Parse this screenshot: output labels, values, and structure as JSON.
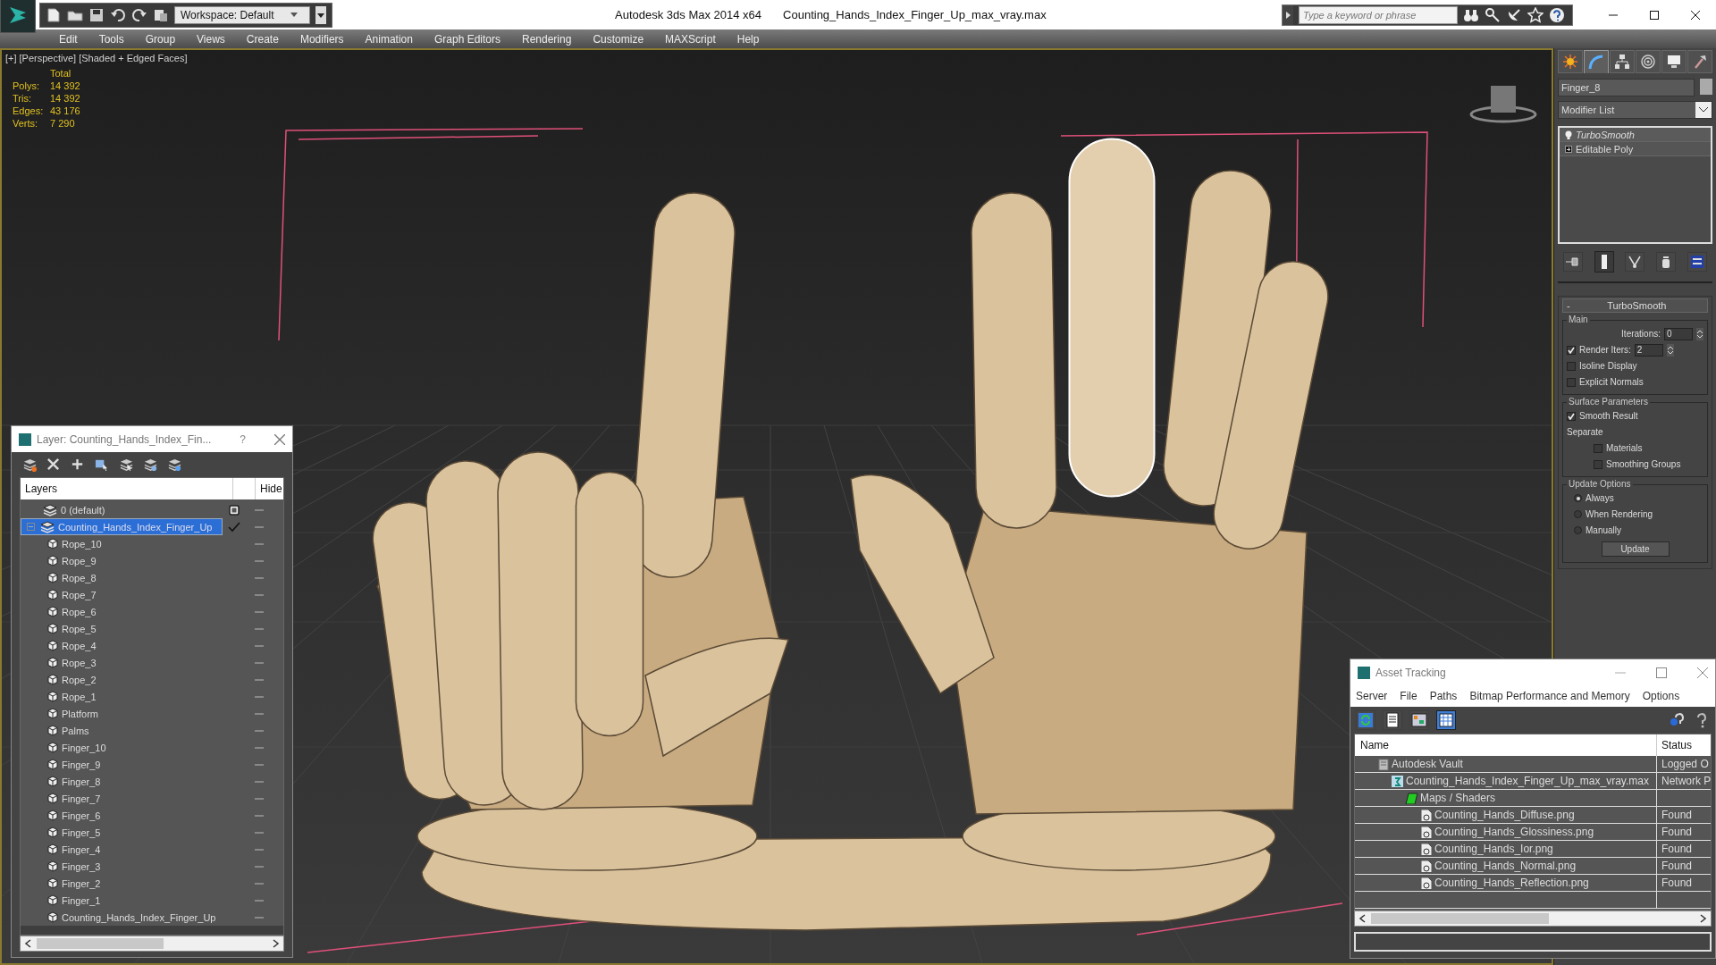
{
  "title_bar": {
    "app": "Autodesk 3ds Max  2014 x64",
    "file": "Counting_Hands_Index_Finger_Up_max_vray.max",
    "workspace": "Workspace: Default",
    "search": {
      "placeholder": "Type a keyword or phrase"
    }
  },
  "menu": [
    "Edit",
    "Tools",
    "Group",
    "Views",
    "Create",
    "Modifiers",
    "Animation",
    "Graph Editors",
    "Rendering",
    "Customize",
    "MAXScript",
    "Help"
  ],
  "viewport": {
    "labels": [
      "[+]",
      "[Perspective]",
      "[Shaded + Edged Faces]"
    ],
    "stats": {
      "header": "Total",
      "rows": [
        {
          "label": "Polys:",
          "value": "14 392"
        },
        {
          "label": "Tris:",
          "value": "14 392"
        },
        {
          "label": "Edges:",
          "value": "43 176"
        },
        {
          "label": "Verts:",
          "value": "7 290"
        }
      ]
    }
  },
  "command_panel": {
    "tabs": [
      {
        "kind": "create",
        "selected": false
      },
      {
        "kind": "modify",
        "selected": true
      },
      {
        "kind": "hierarchy",
        "selected": false
      },
      {
        "kind": "motion",
        "selected": false
      },
      {
        "kind": "display",
        "selected": false
      },
      {
        "kind": "utilities",
        "selected": false
      }
    ],
    "object_name": "Finger_8",
    "modifier_list": "Modifier List",
    "stack": [
      {
        "name": "TurboSmooth",
        "viewport_off": true,
        "expandable": false
      },
      {
        "name": "Editable Poly",
        "viewport_off": false,
        "expandable": true
      }
    ],
    "stack_tools": [
      {
        "kind": "pin",
        "selected": false
      },
      {
        "kind": "end_result",
        "selected": true
      },
      {
        "kind": "unique",
        "selected": false
      },
      {
        "kind": "remove",
        "selected": false
      },
      {
        "kind": "configure",
        "selected": false
      }
    ],
    "rollout": {
      "collapse": "-",
      "title": "TurboSmooth",
      "groups": [
        {
          "title": "Main",
          "controls": [
            {
              "kind": "spinner",
              "label": "Iterations:",
              "value": "0"
            },
            {
              "kind": "check_spinner",
              "label": "Render Iters:",
              "value": "2",
              "checked": true
            },
            {
              "kind": "checkbox",
              "label": "Isoline Display",
              "checked": false
            },
            {
              "kind": "checkbox",
              "label": "Explicit Normals",
              "checked": false
            }
          ]
        },
        {
          "title": "Surface Parameters",
          "controls": [
            {
              "kind": "checkbox",
              "label": "Smooth Result",
              "checked": true
            },
            {
              "kind": "label",
              "label": "Separate"
            },
            {
              "kind": "subcheckbox",
              "label": "Materials",
              "checked": false
            },
            {
              "kind": "subcheckbox",
              "label": "Smoothing Groups",
              "checked": false
            }
          ]
        },
        {
          "title": "Update Options",
          "controls": [
            {
              "kind": "radio",
              "label": "Always",
              "selected": true
            },
            {
              "kind": "radio",
              "label": "When Rendering",
              "selected": false
            },
            {
              "kind": "radio",
              "label": "Manually",
              "selected": false
            },
            {
              "kind": "button",
              "label": "Update"
            }
          ]
        }
      ]
    }
  },
  "layer_window": {
    "title": "Layer: Counting_Hands_Index_Fin...",
    "help": "?",
    "columns": [
      "Layers",
      "Hide"
    ],
    "layers": [
      {
        "name": "0 (default)",
        "kind": "layer",
        "current": false,
        "selected": false
      },
      {
        "name": "Counting_Hands_Index_Finger_Up",
        "kind": "layer",
        "current": true,
        "selected": true,
        "expanded": true,
        "children": [
          {
            "name": "Rope_10",
            "kind": "object"
          },
          {
            "name": "Rope_9",
            "kind": "object"
          },
          {
            "name": "Rope_8",
            "kind": "object"
          },
          {
            "name": "Rope_7",
            "kind": "object"
          },
          {
            "name": "Rope_6",
            "kind": "object"
          },
          {
            "name": "Rope_5",
            "kind": "object"
          },
          {
            "name": "Rope_4",
            "kind": "object"
          },
          {
            "name": "Rope_3",
            "kind": "object"
          },
          {
            "name": "Rope_2",
            "kind": "object"
          },
          {
            "name": "Rope_1",
            "kind": "object"
          },
          {
            "name": "Platform",
            "kind": "object"
          },
          {
            "name": "Palms",
            "kind": "object"
          },
          {
            "name": "Finger_10",
            "kind": "object"
          },
          {
            "name": "Finger_9",
            "kind": "object"
          },
          {
            "name": "Finger_8",
            "kind": "object"
          },
          {
            "name": "Finger_7",
            "kind": "object"
          },
          {
            "name": "Finger_6",
            "kind": "object"
          },
          {
            "name": "Finger_5",
            "kind": "object"
          },
          {
            "name": "Finger_4",
            "kind": "object"
          },
          {
            "name": "Finger_3",
            "kind": "object"
          },
          {
            "name": "Finger_2",
            "kind": "object"
          },
          {
            "name": "Finger_1",
            "kind": "object"
          },
          {
            "name": "Counting_Hands_Index_Finger_Up",
            "kind": "object"
          }
        ]
      }
    ]
  },
  "asset_window": {
    "title": "Asset Tracking",
    "menu": [
      "Server",
      "File",
      "Paths",
      "Bitmap Performance and Memory",
      "Options"
    ],
    "toolbar": [
      {
        "kind": "refresh",
        "selected": false
      },
      {
        "kind": "list",
        "selected": false
      },
      {
        "kind": "thumbnails",
        "selected": false
      },
      {
        "kind": "table",
        "selected": true
      }
    ],
    "columns": [
      "Name",
      "Status"
    ],
    "rows": [
      {
        "name": "Autodesk Vault",
        "kind": "vault",
        "status": "Logged O",
        "children": [
          {
            "name": "Counting_Hands_Index_Finger_Up_max_vray.max",
            "kind": "max",
            "status": "Network P",
            "children": [
              {
                "name": "Maps / Shaders",
                "kind": "folder",
                "children": [
                  {
                    "name": "Counting_Hands_Diffuse.png",
                    "kind": "image",
                    "status": "Found"
                  },
                  {
                    "name": "Counting_Hands_Glossiness.png",
                    "kind": "image",
                    "status": "Found"
                  },
                  {
                    "name": "Counting_Hands_Ior.png",
                    "kind": "image",
                    "status": "Found"
                  },
                  {
                    "name": "Counting_Hands_Normal.png",
                    "kind": "image",
                    "status": "Found"
                  },
                  {
                    "name": "Counting_Hands_Reflection.png",
                    "kind": "image",
                    "status": "Found"
                  }
                ]
              }
            ]
          }
        ]
      }
    ]
  }
}
